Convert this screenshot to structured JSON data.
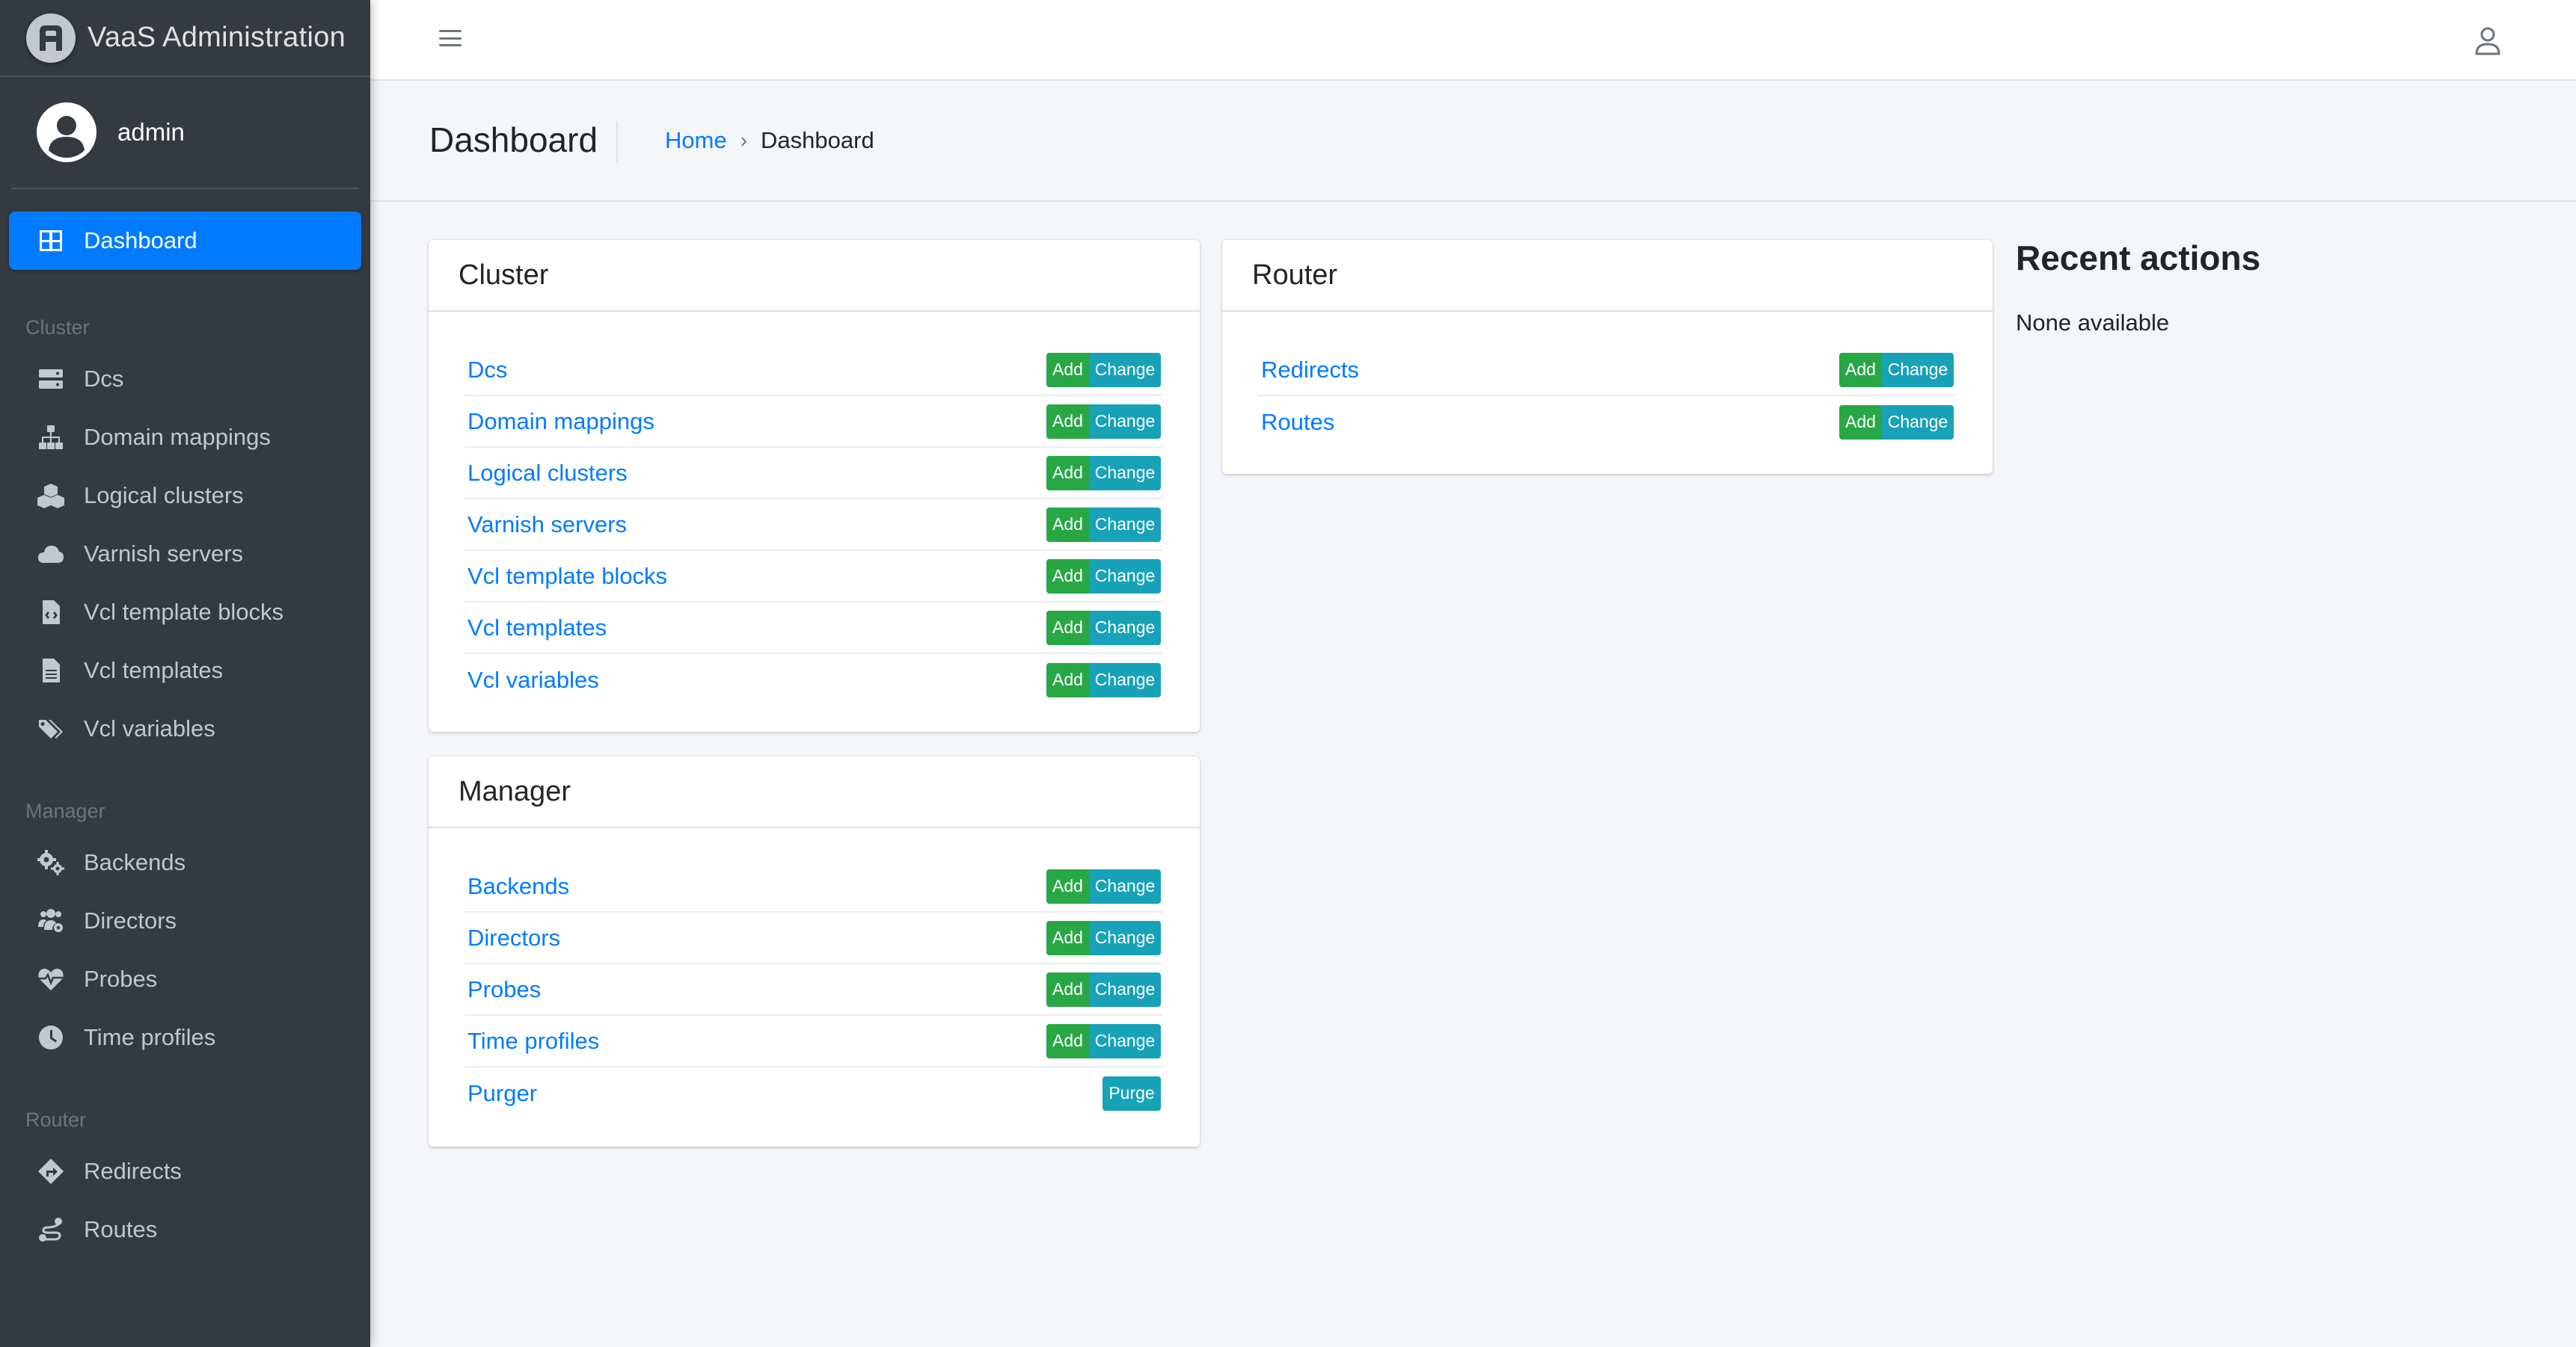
{
  "brand": {
    "title": "VaaS Administration",
    "logo_letter": "A"
  },
  "user": {
    "name": "admin"
  },
  "sidebar": {
    "dashboard": "Dashboard",
    "sections": [
      {
        "header": "Cluster",
        "items": [
          "Dcs",
          "Domain mappings",
          "Logical clusters",
          "Varnish servers",
          "Vcl template blocks",
          "Vcl templates",
          "Vcl variables"
        ]
      },
      {
        "header": "Manager",
        "items": [
          "Backends",
          "Directors",
          "Probes",
          "Time profiles"
        ]
      },
      {
        "header": "Router",
        "items": [
          "Redirects",
          "Routes"
        ]
      }
    ]
  },
  "header": {
    "title": "Dashboard",
    "breadcrumb": {
      "home": "Home",
      "separator": "›",
      "current": "Dashboard"
    }
  },
  "buttons": {
    "add": "Add",
    "change": "Change",
    "purge": "Purge"
  },
  "cards": {
    "cluster": {
      "title": "Cluster",
      "rows": [
        "Dcs",
        "Domain mappings",
        "Logical clusters",
        "Varnish servers",
        "Vcl template blocks",
        "Vcl templates",
        "Vcl variables"
      ]
    },
    "manager": {
      "title": "Manager",
      "rows": [
        "Backends",
        "Directors",
        "Probes",
        "Time profiles",
        "Purger"
      ]
    },
    "router": {
      "title": "Router",
      "rows": [
        "Redirects",
        "Routes"
      ]
    }
  },
  "recent": {
    "title": "Recent actions",
    "empty": "None available"
  },
  "colors": {
    "sidebar": "#343a40",
    "active": "#007bff",
    "add": "#28a745",
    "change": "#17a2b8",
    "link": "#007bff"
  }
}
